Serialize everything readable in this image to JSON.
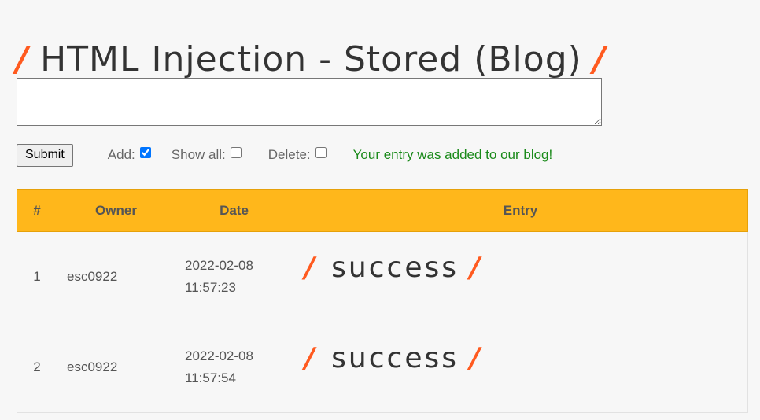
{
  "header": {
    "title": "HTML Injection - Stored (Blog)",
    "slash": "/"
  },
  "form": {
    "entry_value": "",
    "submit_label": "Submit",
    "add_label": "Add:",
    "add_checked": true,
    "show_all_label": "Show all:",
    "show_all_checked": false,
    "delete_label": "Delete:",
    "delete_checked": false,
    "status_message": "Your entry was added to our blog!"
  },
  "table": {
    "headers": {
      "num": "#",
      "owner": "Owner",
      "date": "Date",
      "entry": "Entry"
    },
    "rows": [
      {
        "num": "1",
        "owner": "esc0922",
        "date": "2022-02-08",
        "time": "11:57:23",
        "entry": "success"
      },
      {
        "num": "2",
        "owner": "esc0922",
        "date": "2022-02-08",
        "time": "11:57:54",
        "entry": "success"
      }
    ]
  },
  "colors": {
    "accent": "#ff5a1f",
    "header_bg": "#ffb71b",
    "status_text": "#1a8a1a"
  }
}
